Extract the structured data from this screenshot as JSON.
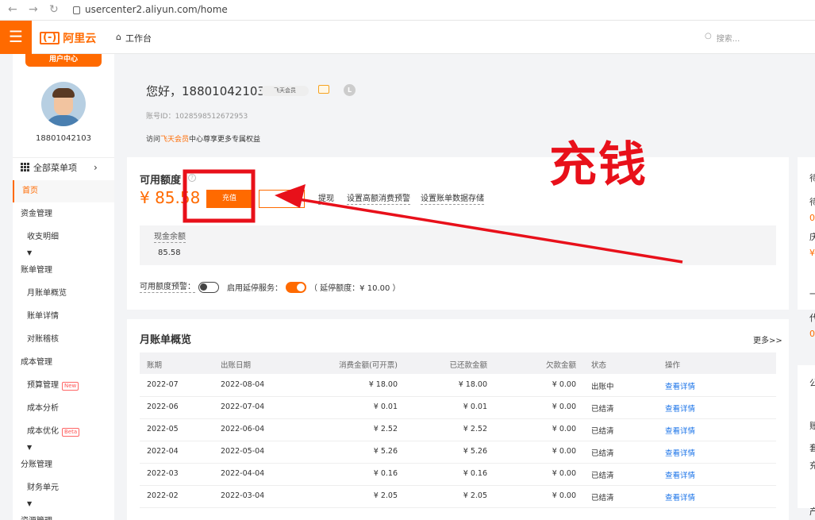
{
  "browser": {
    "url": "usercenter2.aliyun.com/home"
  },
  "header": {
    "brand": "阿里云",
    "logo_mark": "(-)",
    "workbench": "工作台",
    "search_placeholder": "搜索..."
  },
  "sidebar": {
    "tag": "用户中心",
    "phone": "18801042103",
    "all_menu": "全部菜单项",
    "items": [
      {
        "label": "首页"
      },
      {
        "label": "资金管理"
      },
      {
        "label": "收支明细"
      },
      {
        "label": "账单管理"
      },
      {
        "label": "月账单概览"
      },
      {
        "label": "账单详情"
      },
      {
        "label": "对账稽核"
      },
      {
        "label": "成本管理"
      },
      {
        "label": "预算管理",
        "badge": "New"
      },
      {
        "label": "成本分析"
      },
      {
        "label": "成本优化",
        "badge": "Beta"
      },
      {
        "label": "分账管理"
      },
      {
        "label": "财务单元"
      },
      {
        "label": "资源管理"
      }
    ]
  },
  "profile": {
    "greeting": "您好，18801042103",
    "member_badge": "飞天会员",
    "level": "L",
    "account": "账号ID：1028598512672953",
    "visit_prefix": "访问",
    "visit_link": "飞天会员",
    "visit_suffix": "中心尊享更多专属权益"
  },
  "balance_card": {
    "title": "可用额度",
    "help": "?",
    "amount": "¥ 85.58",
    "recharge_label": "充值",
    "withdraw_label": "提现",
    "alert_label": "设置高额消费预警",
    "storage_label": "设置账单数据存储",
    "cash_label": "现金余额",
    "cash_value": "85.58",
    "quota_alert": "可用额度预警：",
    "extend_service": "启用延停服务：",
    "extend_quota": "（ 延停额度：¥ 10.00 ）"
  },
  "monthly": {
    "title": "月账单概览",
    "more": "更多>>",
    "columns": [
      "账期",
      "出账日期",
      "消费金额(可开票)",
      "已还款金额",
      "欠款金额",
      "状态",
      "操作"
    ],
    "rows": [
      [
        "2022-07",
        "2022-08-04",
        "¥ 18.00",
        "¥ 18.00",
        "¥ 0.00",
        "出账中",
        "查看详情"
      ],
      [
        "2022-06",
        "2022-07-04",
        "¥ 0.01",
        "¥ 0.01",
        "¥ 0.00",
        "已结清",
        "查看详情"
      ],
      [
        "2022-05",
        "2022-06-04",
        "¥ 2.52",
        "¥ 2.52",
        "¥ 0.00",
        "已结清",
        "查看详情"
      ],
      [
        "2022-04",
        "2022-05-04",
        "¥ 5.26",
        "¥ 5.26",
        "¥ 0.00",
        "已结清",
        "查看详情"
      ],
      [
        "2022-03",
        "2022-04-04",
        "¥ 0.16",
        "¥ 0.16",
        "¥ 0.00",
        "已结清",
        "查看详情"
      ],
      [
        "2022-02",
        "2022-03-04",
        "¥ 2.05",
        "¥ 2.05",
        "¥ 0.00",
        "已结清",
        "查看详情"
      ]
    ]
  },
  "annotation": {
    "text": "充钱",
    "color": "#e8101a"
  },
  "right_panel": {
    "lines": [
      "待",
      "待",
      "0",
      "庆",
      "¥",
      "一",
      "代",
      "0",
      "公",
      "账",
      "套",
      "充",
      "产"
    ]
  },
  "colors": {
    "accent": "#ff6a00",
    "link": "#1a73e8",
    "annotation": "#e8101a"
  }
}
